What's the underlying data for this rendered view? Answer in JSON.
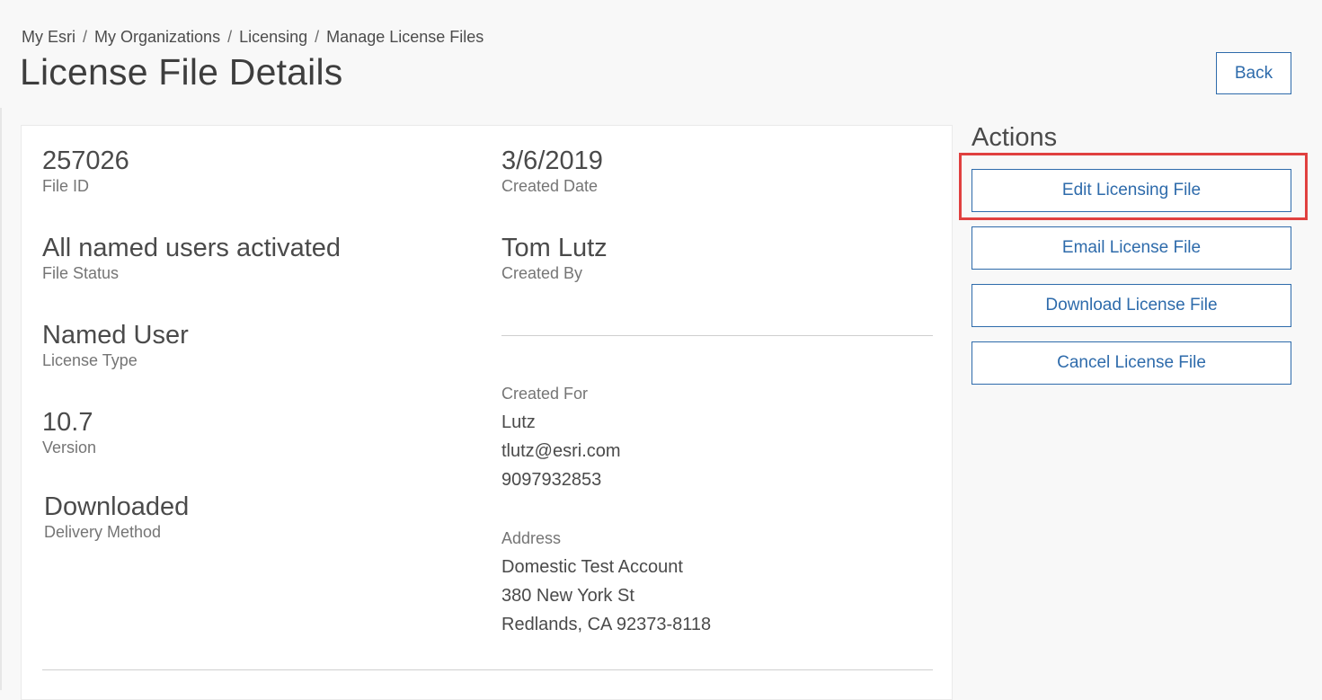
{
  "breadcrumb": {
    "items": [
      "My Esri",
      "My Organizations",
      "Licensing",
      "Manage License Files"
    ],
    "separator": "/"
  },
  "page": {
    "title": "License File Details",
    "back_label": "Back"
  },
  "details": {
    "file_id": {
      "value": "257026",
      "label": "File ID"
    },
    "file_status": {
      "value": "All named users activated",
      "label": "File Status"
    },
    "license_type": {
      "value": "Named User",
      "label": "License Type"
    },
    "version": {
      "value": "10.7",
      "label": "Version"
    },
    "delivery_method": {
      "value": "Downloaded",
      "label": "Delivery Method"
    },
    "created_date": {
      "value": "3/6/2019",
      "label": "Created Date"
    },
    "created_by": {
      "value": "Tom Lutz",
      "label": "Created By"
    }
  },
  "created_for": {
    "label": "Created For",
    "name": "Lutz",
    "email": "tlutz@esri.com",
    "phone": "9097932853"
  },
  "address": {
    "label": "Address",
    "line1": "Domestic Test Account",
    "line2": "380 New York St",
    "line3": "Redlands, CA 92373-8118"
  },
  "actions": {
    "title": "Actions",
    "edit_label": "Edit Licensing File",
    "email_label": "Email License File",
    "download_label": "Download License File",
    "cancel_label": "Cancel License File"
  },
  "colors": {
    "accent": "#2e6bab",
    "highlight": "#e0403f",
    "background": "#f8f8f8",
    "card": "#ffffff"
  }
}
